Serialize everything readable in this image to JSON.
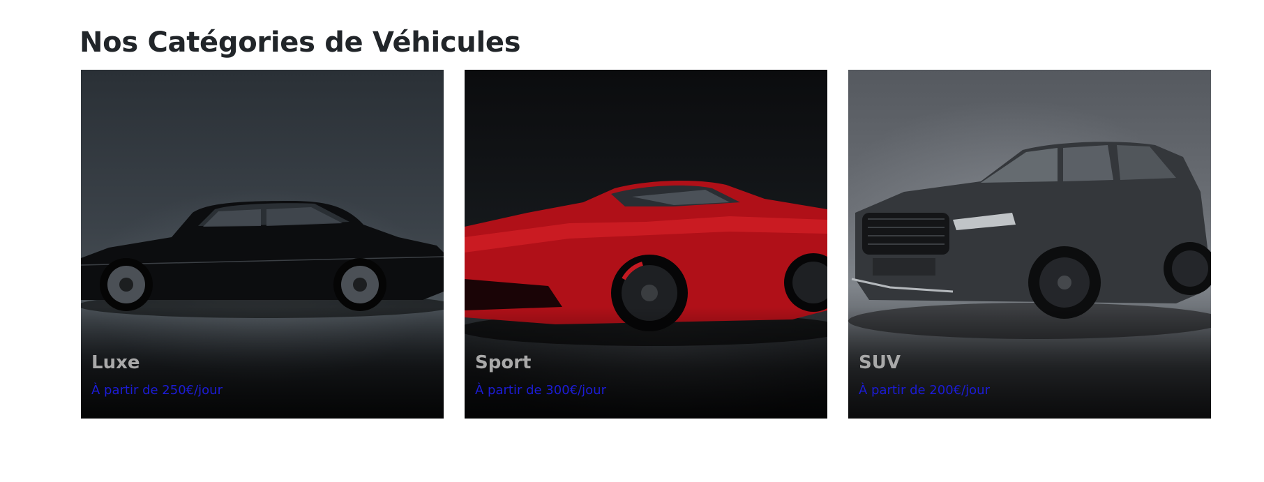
{
  "section": {
    "title": "Nos Catégories de Véhicules"
  },
  "categories": [
    {
      "name": "Luxe",
      "price": "À partir de 250€/jour",
      "image_icon": "black-luxury-sedan-photo"
    },
    {
      "name": "Sport",
      "price": "À partir de 300€/jour",
      "image_icon": "red-sports-car-photo"
    },
    {
      "name": "SUV",
      "price": "À partir de 200€/jour",
      "image_icon": "dark-grey-suv-photo"
    }
  ],
  "colors": {
    "title": "#212529",
    "category_name": "#a9a9a9",
    "price": "#1c1cd6"
  }
}
